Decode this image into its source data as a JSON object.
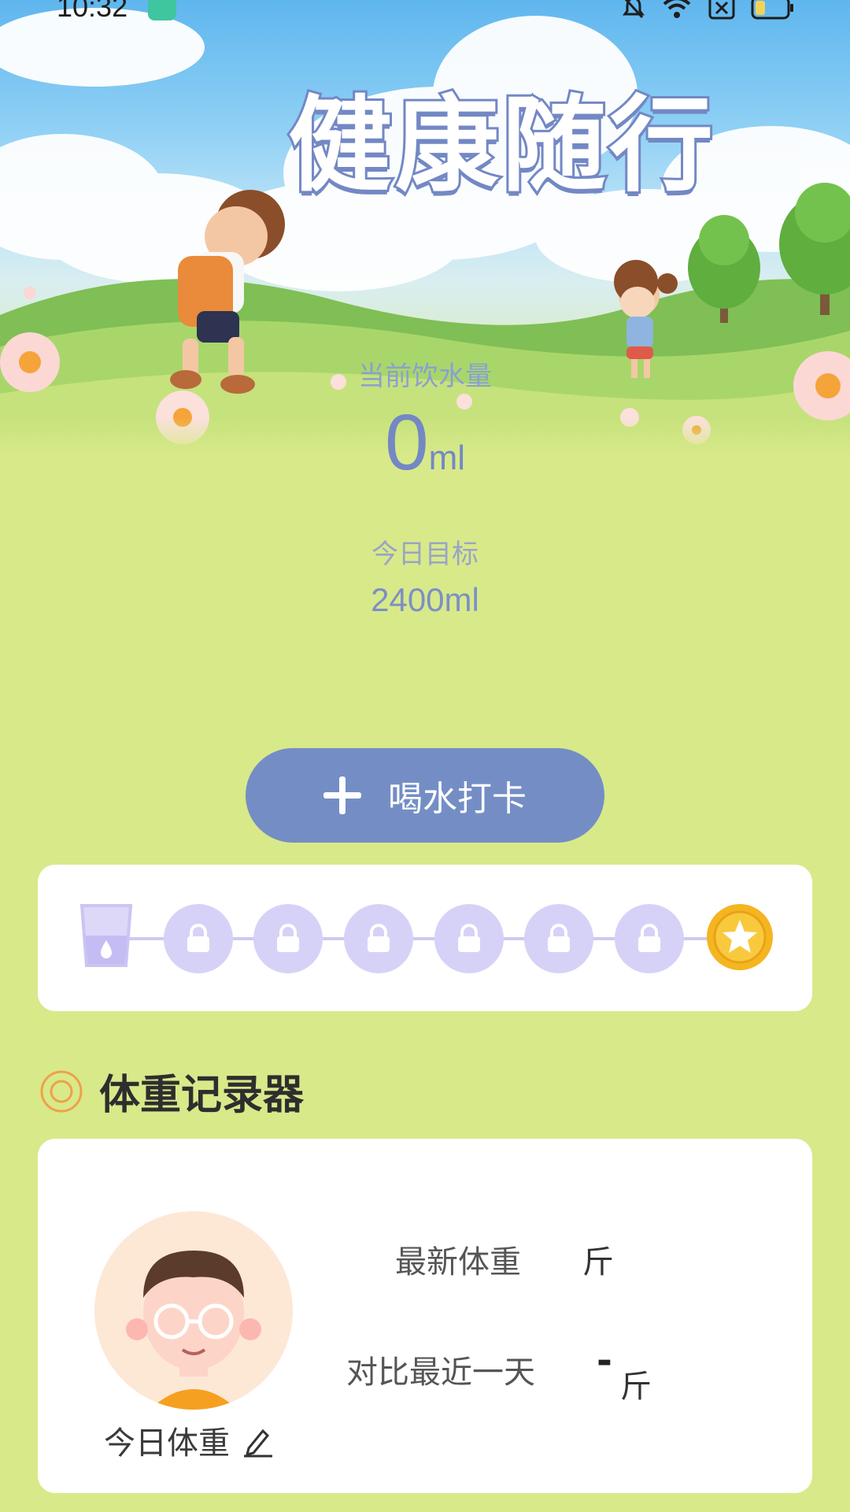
{
  "status_bar": {
    "time": "10:32"
  },
  "hero": {
    "title": "健康随行"
  },
  "water": {
    "current_label": "当前饮水量",
    "current_value": "0",
    "current_unit": "ml",
    "goal_label": "今日目标",
    "goal_value": "2400ml"
  },
  "checkin_button": {
    "label": "喝水打卡"
  },
  "progress": {
    "steps": [
      "cup-icon",
      "lock-icon",
      "lock-icon",
      "lock-icon",
      "lock-icon",
      "lock-icon",
      "lock-icon",
      "star-coin-icon"
    ],
    "completed": 0,
    "colors": {
      "locked": "#d6d2f7",
      "line": "#cfc9f1",
      "coin": "#f5b521"
    }
  },
  "weight": {
    "section_title": "体重记录器",
    "latest_label": "最新体重",
    "latest_unit": "斤",
    "compare_label": "对比最近一天",
    "compare_value": "-",
    "compare_unit": "斤",
    "today_label": "今日体重"
  },
  "colors": {
    "background": "#d8e98a",
    "accent": "#748ec5",
    "title_stroke": "#7388c4",
    "section_icon": "#f0a04a"
  }
}
